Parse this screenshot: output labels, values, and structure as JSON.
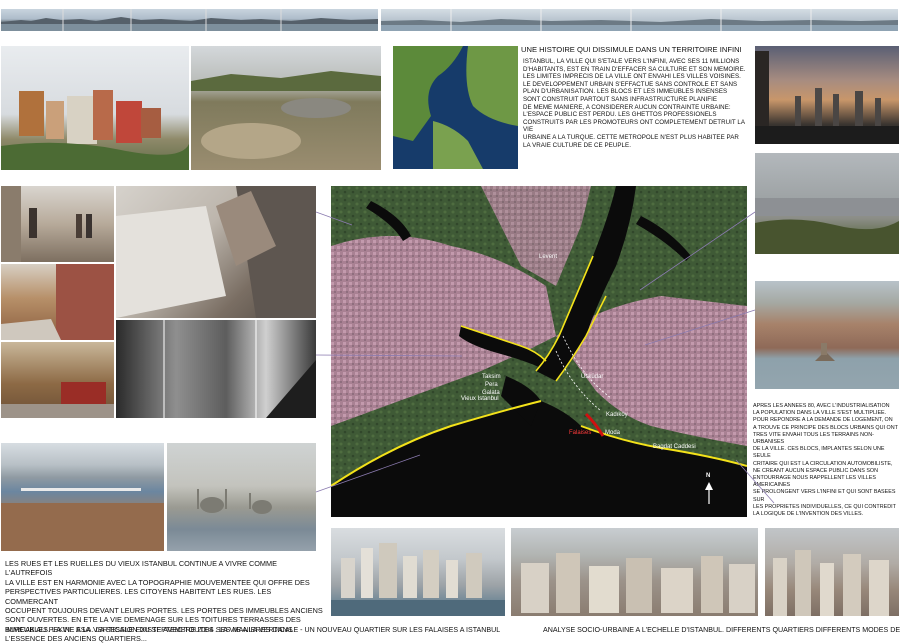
{
  "title": "UNE HISTOIRE QUI DISSIMULE DANS UN TERRITOIRE INFINI",
  "intro_lines": [
    "ISTANBUL, LA VILLE QUI S'ETALE VERS L'INFINI, AVEC SES 11 MILLIONS",
    "D'HABITANTS, EST EN TRAIN D'EFFACER SA CULTURE ET SON MEMOIRE.",
    "LES LIMITES IMPRECIS DE LA VILLE ONT ENVAHI LES VILLES VOISINES.",
    "LE DEVELOPPEMENT URBAIN S'EFFACTUE SANS CONTROLE ET SANS",
    "PLAN D'URBANISATION. LES BLOCS ET LES IMMEUBLES  INSENSES",
    "SONT CONSTRUIT PARTOUT SANS INFRASTRUCTURE PLANIFIE",
    "DE MEME MANIERE, A CONSIDERER AUCUN CONTRAINTE URBAINE:",
    "L'ESPACE PUBLIC EST PERDU. LES GHETTOS PROFESSIONELS",
    "CONSTRUITS PAR LES PROMOTEURS ONT COMPLETEMENT DETRUIT LA VIE",
    "URBAINE A LA TURQUE.  CETTE METROPOLE N'EST PLUS HABITEE PAR",
    "LA VRAIE CULTURE DE CE PEUPLE."
  ],
  "right_text_lines": [
    "APRES LES ANNEES 80, AVEC L'INDUSTRIALISATION",
    "LA POPULATION DANS LA VILLE S'EST MULTIPLIEE.",
    "POUR REPONDRE A LA DEMANDE DE LOGEMENT, ON",
    "A TROUVE CE PRINCIPE DES BLOCS URBAINS QUI ONT",
    "TRES VITE ENVAHI TOUS LES TERRAINS NON-URBANISES",
    "DE LA VILLE. CES BLOCS, IMPLANTES SELON UNE SEULE",
    "CRITAIRE QUI EST LA CIRCULATION AUTOMOBILISTE,",
    "NE CREANT AUCUN ESPACE PUBLIC DANS SON",
    "ENTOURRAGE NOUS RAPPELLENT LES VILLES AMERICAINES",
    "SE PROLONGENT VERS L'INFINI ET QUI SONT BASEES SUR",
    "LES PROPRIETES INDIVIDUELLES, CE QUI CONTREDIT",
    "LA LOGIQUE DE L'INVENTION DES VILLES."
  ],
  "left_text_lines": [
    "LES RUES ET LES RUELLES DU VIEUX ISTANBUL CONTINUE A VIVRE COMME L'AUTREFOIS",
    "LA VILLE EST EN HARMONIE AVEC LA TOPOGRAPHIE MOUVEMENTEE QUI OFFRE DES",
    "PERSPECTIVES PARTICULIERES. LES CITOYENS HABITENT LES RUES. LES COMMERCANT",
    "OCCUPENT TOUJOURS DEVANT LEURS PORTES. LES PORTES DES IMMEUBLES ANCIENS",
    "SONT OUVERTES. EN ETE LA VIE DEMENAGE SUR LES TOITURES TERRASSES DES",
    "IMMEUBLES. LA VIE A LA VERTICALE EXISTE AVEC TOUTES SES MANIERES DANS",
    "L'ESSENCE DES ANCIENS QUARTIERS..."
  ],
  "map_labels": {
    "levent": "Levent",
    "taksim": "Taksim",
    "pera": "Pera",
    "galata": "Galata",
    "uskudar": "Üsküdar",
    "vieux_istanbul": "Vieux Istanbul",
    "kadikoy": "Kadıköy",
    "falaises": "Falaises",
    "moda": "Moda",
    "bagdat": "Bagdat Caddesi",
    "north": "N"
  },
  "footer": {
    "left": "BURCAK ALI PEKIN . ESA . LA SESSION DU SEPTEMBRE 2004 . LA VIE A LA VERTICALE - UN NOUVEAU QUARTIER SUR LES FALAISES A ISTANBUL",
    "right": "ANALYSE SOCIO-URBAINE A L'ECHELLE D'ISTANBUL. DIFFERENTS QUARTIERS DIFFERENTS MODES DE VIE"
  },
  "colors": {
    "water_dark": "#0b0b0b",
    "coast_line": "#f3e21a",
    "cliff_red": "#d01010",
    "urban_pink": "#b98aa0",
    "vegetation": "#3e5e36"
  }
}
